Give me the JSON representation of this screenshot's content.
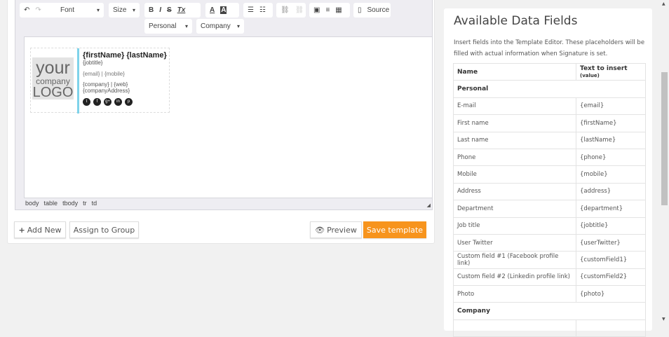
{
  "toolbar": {
    "font": "Font",
    "size": "Size",
    "bold": "B",
    "italic": "I",
    "strike": "S",
    "clear": "Tx",
    "text_color": "A",
    "bg_color": "A",
    "source": "Source",
    "personal": "Personal",
    "company": "Company"
  },
  "signature": {
    "logo": [
      "your",
      "company",
      "LOGO"
    ],
    "name": "{firstName} {lastName}",
    "jobtitle": "{jobtitle}",
    "contact": "{email} | {mobile}",
    "company_web": "{company} | {web}",
    "address": "{companyAddress}"
  },
  "path": [
    "body",
    "table",
    "tbody",
    "tr",
    "td"
  ],
  "buttons": {
    "add_new": "Add New",
    "assign": "Assign to Group",
    "preview": "Preview",
    "save": "Save template"
  },
  "accent": "#f7941d",
  "panel": {
    "title": "Available Data Fields",
    "description": "Insert fields into the Template Editor. These placeholders will be filled with actual information when Signature is set.",
    "col_name": "Name",
    "col_value": "Text to insert",
    "col_value_small": "(value)",
    "rows": [
      {
        "group": "Personal"
      },
      {
        "name": "E-mail",
        "value": "{email}"
      },
      {
        "name": "First name",
        "value": "{firstName}"
      },
      {
        "name": "Last name",
        "value": "{lastName}"
      },
      {
        "name": "Phone",
        "value": "{phone}"
      },
      {
        "name": "Mobile",
        "value": "{mobile}"
      },
      {
        "name": "Address",
        "value": "{address}"
      },
      {
        "name": "Department",
        "value": "{department}"
      },
      {
        "name": "Job title",
        "value": "{jobtitle}"
      },
      {
        "name": "User Twitter",
        "value": "{userTwitter}"
      },
      {
        "name": "Custom field #1 (Facebook profile link)",
        "value": "{customField1}"
      },
      {
        "name": "Custom field #2 (Linkedin profile link)",
        "value": "{customField2}"
      },
      {
        "name": "Photo",
        "value": "{photo}"
      },
      {
        "group": "Company"
      },
      {
        "name": "",
        "value": ""
      }
    ]
  }
}
